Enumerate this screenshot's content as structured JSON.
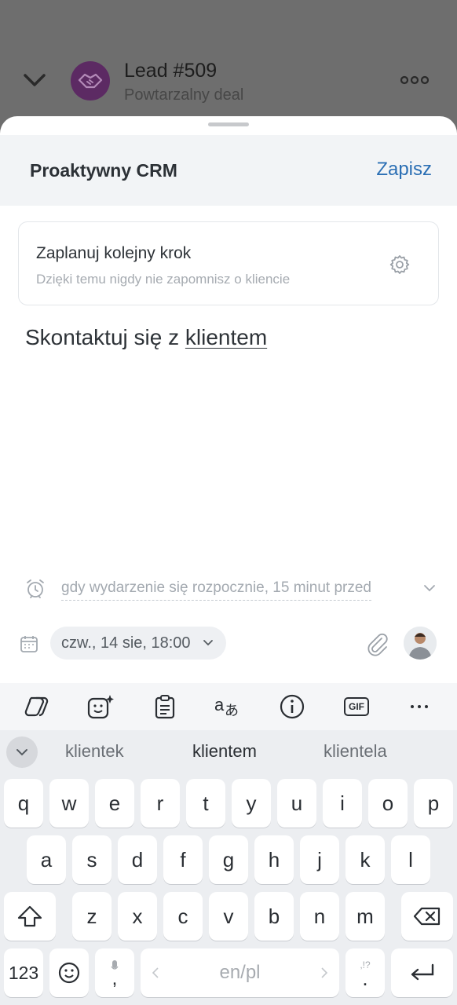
{
  "background": {
    "title": "Lead #509",
    "subtitle": "Powtarzalny deal",
    "avatar_color": "#5c2a63",
    "icons": [
      "chevron-down-icon",
      "handshake-icon",
      "more-icon"
    ]
  },
  "sheet": {
    "title": "Proaktywny CRM",
    "save_label": "Zapisz",
    "save_color": "#2b6fb4",
    "plan": {
      "title": "Zaplanuj kolejny krok",
      "subtitle": "Dzięki temu nigdy nie zapomnisz o kliencie",
      "icon": "gear-icon"
    },
    "task": {
      "text_before": "Skontaktuj się z ",
      "text_underlined": "klientem"
    },
    "reminder": {
      "text": "gdy wydarzenie się rozpocznie, 15 minut przed",
      "icon": "alarm-icon"
    },
    "date": {
      "value": "czw., 14 sie, 18:00",
      "icon": "calendar-icon"
    }
  },
  "keyboard": {
    "toolbar_icons": [
      "copilot-icon",
      "sticker-icon",
      "clipboard-icon",
      "translate-icon",
      "info-icon",
      "gif-icon",
      "more-icon"
    ],
    "gif_label": "GIF",
    "suggestions": [
      "klientek",
      "klientem",
      "klientela"
    ],
    "rows": [
      [
        "q",
        "w",
        "e",
        "r",
        "t",
        "y",
        "u",
        "i",
        "o",
        "p"
      ],
      [
        "a",
        "s",
        "d",
        "f",
        "g",
        "h",
        "j",
        "k",
        "l"
      ],
      [
        "z",
        "x",
        "c",
        "v",
        "b",
        "n",
        "m"
      ]
    ],
    "numbers_label": "123",
    "comma_label": ",",
    "space_label": "en/pl",
    "period_label": ".",
    "punct_hint": ",!?"
  }
}
